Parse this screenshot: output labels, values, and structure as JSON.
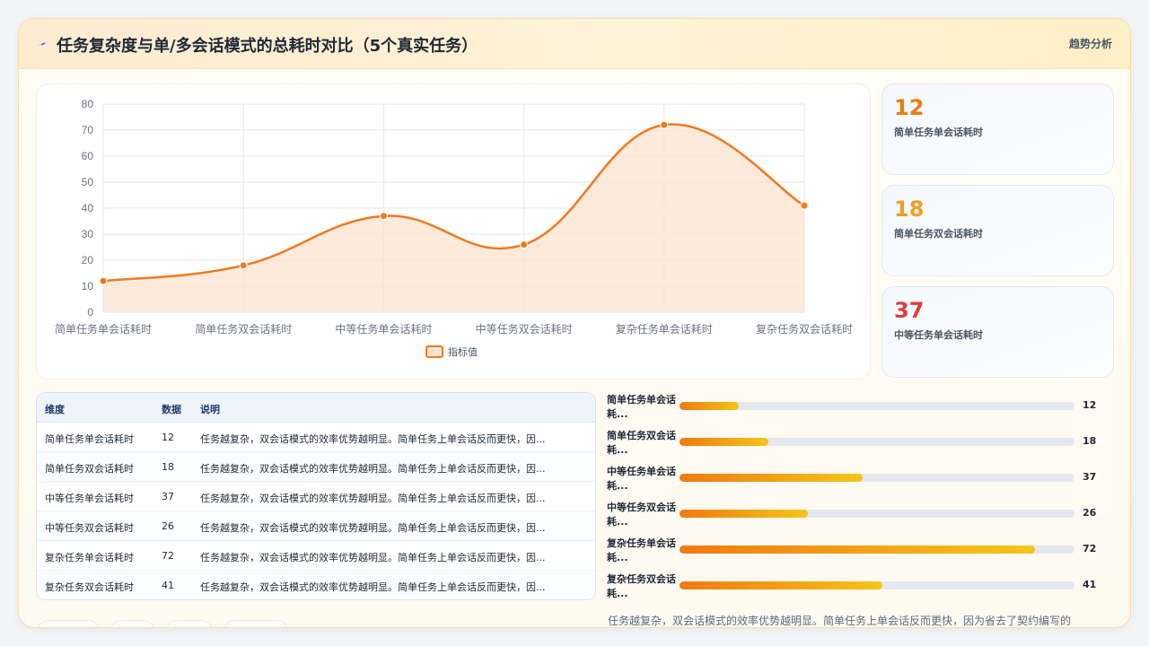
{
  "header": {
    "title": "任务复杂度与单/多会话模式的总耗时对比（5个真实任务）",
    "trend_label": "趋势分析",
    "icon": "lightning-icon"
  },
  "chart_data": {
    "type": "area",
    "categories": [
      "简单任务单会话耗时",
      "简单任务双会话耗时",
      "中等任务单会话耗时",
      "中等任务双会话耗时",
      "复杂任务单会话耗时",
      "复杂任务双会话耗时"
    ],
    "series": [
      {
        "name": "指标值",
        "values": [
          12,
          18,
          37,
          26,
          72,
          41
        ]
      }
    ],
    "ylim": [
      0,
      80
    ],
    "yticks": [
      "0",
      "10",
      "20",
      "30",
      "40",
      "50",
      "60",
      "70",
      "80"
    ],
    "grid": true,
    "legend": "bottom",
    "colors": {
      "line": "#f07a1e",
      "fill": "#fde3cf"
    }
  },
  "stats": [
    {
      "value": "12",
      "label": "简单任务单会话耗时",
      "color": "#ef7a10"
    },
    {
      "value": "18",
      "label": "简单任务双会话耗时",
      "color": "#f0a020"
    },
    {
      "value": "37",
      "label": "中等任务单会话耗时",
      "color": "#e03b3b"
    }
  ],
  "table": {
    "headers": [
      "维度",
      "数据",
      "说明"
    ],
    "rows": [
      [
        "简单任务单会话耗时",
        "12",
        "任务越复杂，双会话模式的效率优势越明显。简单任务上单会话反而更快，因..."
      ],
      [
        "简单任务双会话耗时",
        "18",
        "任务越复杂，双会话模式的效率优势越明显。简单任务上单会话反而更快，因..."
      ],
      [
        "中等任务单会话耗时",
        "37",
        "任务越复杂，双会话模式的效率优势越明显。简单任务上单会话反而更快，因..."
      ],
      [
        "中等任务双会话耗时",
        "26",
        "任务越复杂，双会话模式的效率优势越明显。简单任务上单会话反而更快，因..."
      ],
      [
        "复杂任务单会话耗时",
        "72",
        "任务越复杂，双会话模式的效率优势越明显。简单任务上单会话反而更快，因..."
      ],
      [
        "复杂任务双会话耗时",
        "41",
        "任务越复杂，双会话模式的效率优势越明显。简单任务上单会话反而更快，因..."
      ]
    ]
  },
  "bars": {
    "max": 80,
    "items": [
      {
        "label": "简单任务单会话耗...",
        "value": 12
      },
      {
        "label": "简单任务双会话耗...",
        "value": 18
      },
      {
        "label": "中等任务单会话耗...",
        "value": 37
      },
      {
        "label": "中等任务双会话耗...",
        "value": 26
      },
      {
        "label": "复杂任务单会话耗...",
        "value": 72
      },
      {
        "label": "复杂任务双会话耗...",
        "value": 41
      }
    ]
  },
  "note": "任务越复杂，双会话模式的效率优势越明显。简单任务上单会话反而更快，因为省去了契约编写的"
}
